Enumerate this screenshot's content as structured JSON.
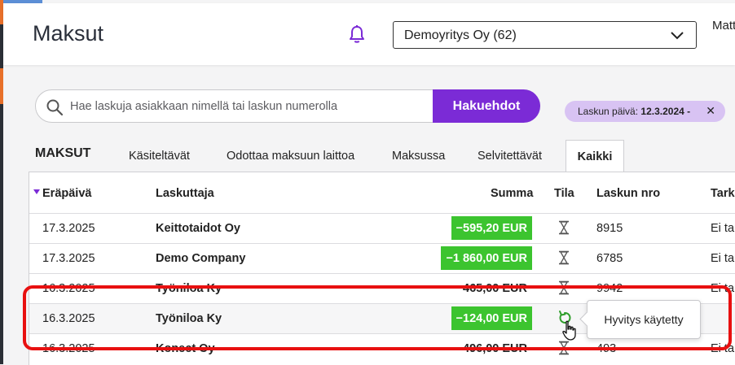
{
  "header": {
    "title": "Maksut",
    "company_select": "Demoyritys Oy (62)",
    "user_name": "Matt"
  },
  "search": {
    "placeholder": "Hae laskuja asiakkaan nimellä tai laskun numerolla",
    "button_label": "Hakuehdot"
  },
  "filter_chip": {
    "label": "Laskun päivä:",
    "value": "12.3.2024 -",
    "close": "✕"
  },
  "section_title": "MAKSUT",
  "tabs": [
    {
      "label": "Käsiteltävät"
    },
    {
      "label": "Odottaa maksuun laittoa"
    },
    {
      "label": "Maksussa"
    },
    {
      "label": "Selvitettävät"
    },
    {
      "label": "Kaikki",
      "active": true
    }
  ],
  "table": {
    "columns": [
      "Eräpäivä",
      "Laskuttaja",
      "Summa",
      "Tila",
      "Laskun nro",
      "Tarka"
    ],
    "rows": [
      {
        "due": "17.3.2025",
        "biller": "Keittotaidot Oy",
        "amount": "−595,20 EUR",
        "amount_style": "green",
        "status_icon": "hourglass-icon",
        "number": "8915",
        "check": "Ei tar"
      },
      {
        "due": "17.3.2025",
        "biller": "Demo Company",
        "amount": "−1 860,00 EUR",
        "amount_style": "green",
        "status_icon": "hourglass-icon",
        "number": "6785",
        "check": "Ei tar"
      },
      {
        "due": "16.3.2025",
        "biller": "Työniloa Ky",
        "amount": "465,00 EUR",
        "amount_style": "plain",
        "status_icon": "hourglass-icon",
        "number": "9942",
        "check": "Ei tar"
      },
      {
        "due": "16.3.2025",
        "biller": "Työniloa Ky",
        "amount": "−124,00 EUR",
        "amount_style": "green",
        "status_icon": "refund-used-icon",
        "number": "",
        "check": ""
      },
      {
        "due": "16.3.2025",
        "biller": "Konect Oy",
        "amount": "496,00 EUR",
        "amount_style": "plain",
        "status_icon": "hourglass-icon",
        "number": "493",
        "check": "Ei tar"
      }
    ]
  },
  "tooltip": "Hyvitys käytetty",
  "colors": {
    "accent": "#7b2bd6",
    "chip": "#d8c3f3",
    "negative_amount": "#3cc42f",
    "highlight_frame": "#e81010"
  }
}
